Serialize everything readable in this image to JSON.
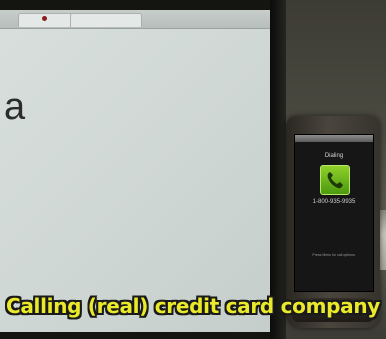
{
  "monitor": {
    "page_letter": "a"
  },
  "phone": {
    "dial_title": "Dialing",
    "number": "1-800-935-9935",
    "hint": "Press Menu for call options."
  },
  "caption": "Calling (real) credit card company"
}
